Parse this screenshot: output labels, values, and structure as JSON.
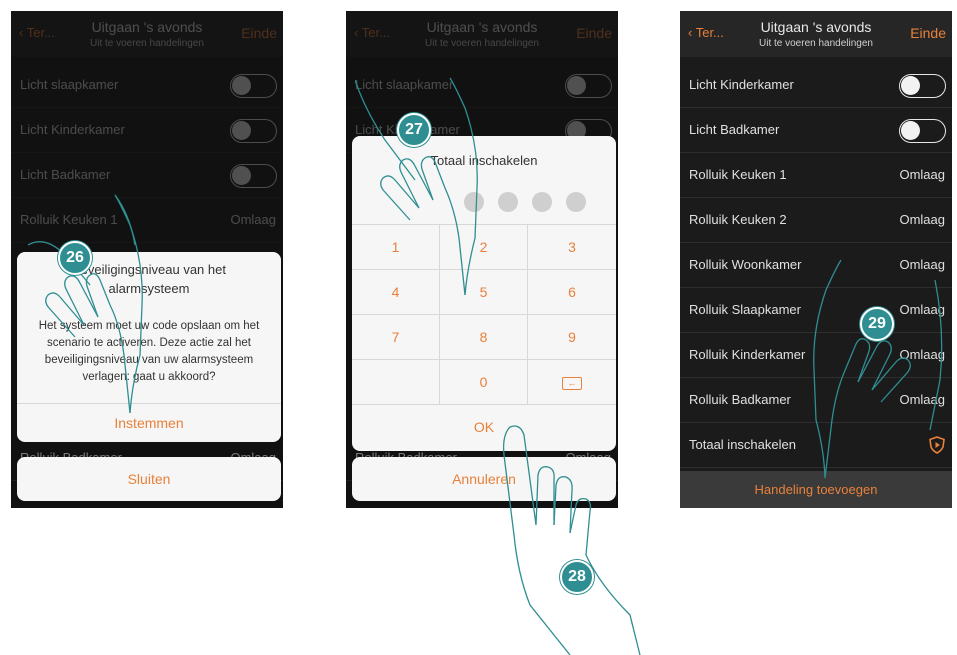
{
  "screens": [
    {
      "header": {
        "back": "Ter...",
        "title": "Uitgaan 's avonds",
        "subtitle": "Uit te voeren handelingen",
        "done": "Einde"
      },
      "rows": [
        {
          "label": "Licht slaapkamer",
          "type": "toggle"
        },
        {
          "label": "Licht Kinderkamer",
          "type": "toggle"
        },
        {
          "label": "Licht Badkamer",
          "type": "toggle"
        },
        {
          "label": "Rolluik Keuken 1",
          "type": "value",
          "value": "Omlaag"
        }
      ],
      "dialog": {
        "title": "Beveiligingsniveau van het alarmsysteem",
        "body": "Het systeem moet uw code opslaan om het scenario te activeren. Deze actie zal het beveiligingsniveau van uw alarmsysteem verlagen: gaat u akkoord?",
        "confirm": "Instemmen",
        "hidden_row_label": "Rolluik Badkamer",
        "hidden_row_value": "Omlaag"
      },
      "close": "Sluiten",
      "step": "26"
    },
    {
      "header": {
        "back": "Ter...",
        "title": "Uitgaan 's avonds",
        "subtitle": "Uit te voeren handelingen",
        "done": "Einde"
      },
      "rows": [
        {
          "label": "Licht slaapkamer",
          "type": "toggle"
        },
        {
          "label": "Licht Kinderkamer",
          "type": "toggle"
        }
      ],
      "keypad": {
        "title": "Totaal inschakelen",
        "keys": [
          "1",
          "2",
          "3",
          "4",
          "5",
          "6",
          "7",
          "8",
          "9",
          "",
          "0",
          "backspace"
        ],
        "ok": "OK",
        "hidden_row_label": "Rolluik Badkamer",
        "hidden_row_value": "Omlaag"
      },
      "cancel": "Annuleren",
      "steps": [
        "27",
        "28"
      ]
    },
    {
      "header": {
        "back": "Ter...",
        "title": "Uitgaan 's avonds",
        "subtitle": "Uit te voeren handelingen",
        "done": "Einde"
      },
      "rows": [
        {
          "label": "Licht Kinderkamer",
          "type": "toggle"
        },
        {
          "label": "Licht Badkamer",
          "type": "toggle"
        },
        {
          "label": "Rolluik Keuken 1",
          "type": "value",
          "value": "Omlaag"
        },
        {
          "label": "Rolluik Keuken 2",
          "type": "value",
          "value": "Omlaag"
        },
        {
          "label": "Rolluik Woonkamer",
          "type": "value",
          "value": "Omlaag"
        },
        {
          "label": "Rolluik Slaapkamer",
          "type": "value",
          "value": "Omlaag"
        },
        {
          "label": "Rolluik Kinderkamer",
          "type": "value",
          "value": "Omlaag"
        },
        {
          "label": "Rolluik Badkamer",
          "type": "value",
          "value": "Omlaag"
        },
        {
          "label": "Totaal inschakelen",
          "type": "icon",
          "icon": "alarm-shield-icon"
        }
      ],
      "add_action": "Handeling toevoegen",
      "step": "29"
    }
  ],
  "colors": {
    "accent": "#e8813a",
    "step_badge": "#2f8e91",
    "background": "#1b1b1b"
  }
}
